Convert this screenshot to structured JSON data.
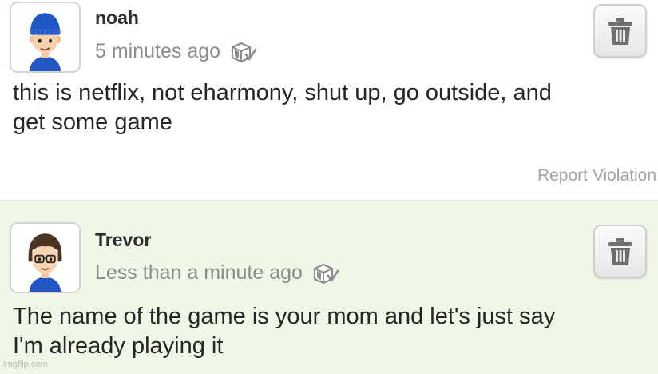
{
  "posts": [
    {
      "author": "noah",
      "timestamp": "5 minutes ago",
      "text_lines": [
        "this is netflix, not eharmony, shut up, go outside, and",
        "get some game"
      ],
      "report_label": "Report Violation",
      "avatar": "mii-avatar-blue-beanie",
      "status_icon": "spoiler-box-check-icon",
      "delete_icon": "trash-icon"
    },
    {
      "author": "Trevor",
      "timestamp": "Less than a minute ago",
      "text_lines": [
        "The name of the game is your mom and let's just say",
        "I'm already playing it"
      ],
      "avatar": "mii-avatar-brown-hair-glasses",
      "status_icon": "spoiler-box-check-icon",
      "delete_icon": "trash-icon"
    }
  ],
  "watermark": "imgflip.com",
  "colors": {
    "reply_background": "#f0f7e6",
    "author_text": "#2e2e2e",
    "timestamp_text": "#8c8c8c",
    "body_text": "#262626"
  }
}
